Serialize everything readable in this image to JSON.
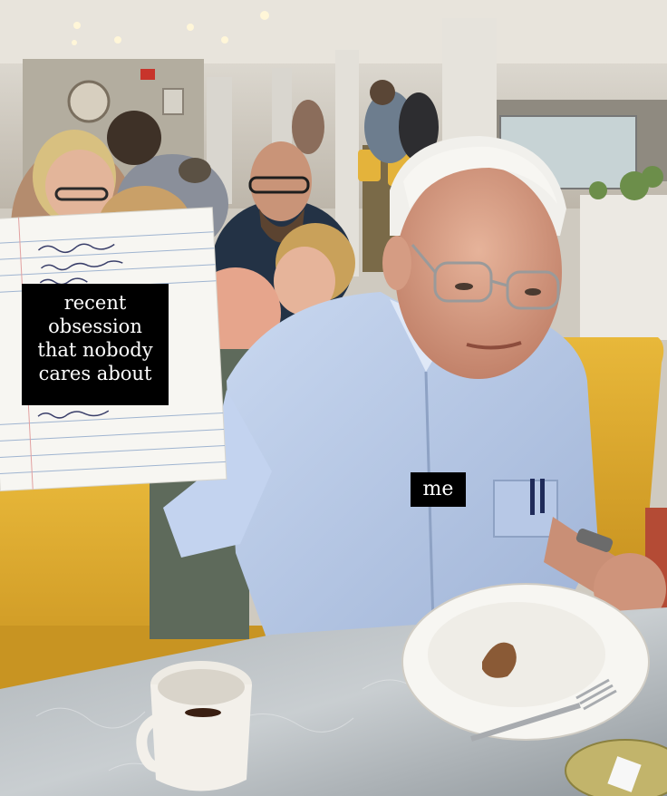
{
  "meme": {
    "paper_caption": [
      "recent",
      "obsession",
      "that nobody",
      "cares about"
    ],
    "person_caption": "me"
  }
}
